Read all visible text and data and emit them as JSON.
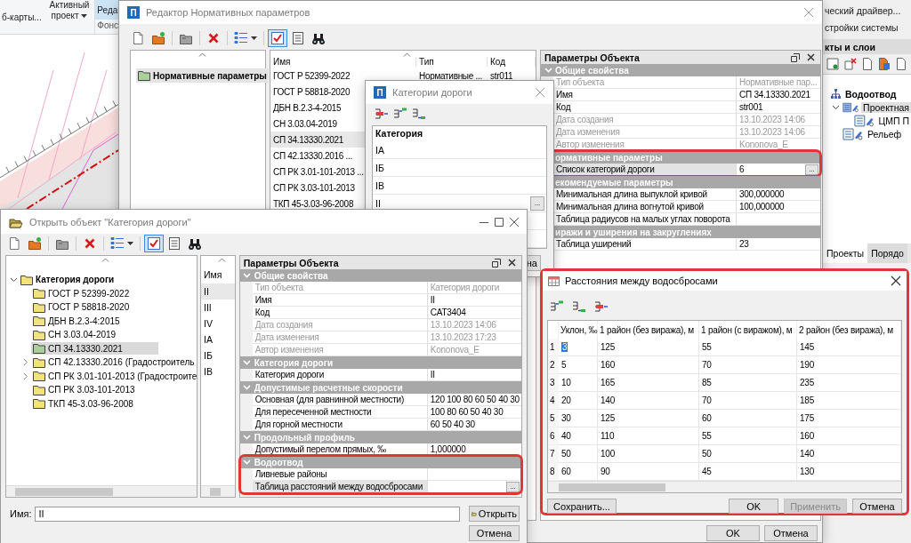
{
  "background_app": {
    "ribbon": [
      {
        "label": "б-карты...",
        "kind": "plain"
      },
      {
        "label": "Активный проект",
        "kind": "dropdown"
      },
      {
        "label": "Реда",
        "kind": "pressed"
      }
    ],
    "ribbon_group": "Фонс",
    "right_ribbon": [
      "ческий драйвер...",
      "стройки системы"
    ],
    "layers_panel": {
      "title": "кты и слои",
      "tree": [
        {
          "label": "Водоотвод",
          "kind": "root",
          "selected": false,
          "children": [
            {
              "label": "Проектная",
              "kind": "surface",
              "expanded": true,
              "selected": true,
              "children": [
                {
                  "label": "ЦМП П",
                  "kind": "surface",
                  "selected": false
                }
              ]
            },
            {
              "label": "Рельеф",
              "kind": "surface",
              "selected": false
            }
          ]
        }
      ]
    },
    "bottom_tabs": [
      {
        "label": "Проекты",
        "selected": true
      },
      {
        "label": "Порядо",
        "selected": false
      }
    ]
  },
  "editor_window": {
    "icon_letter": "П",
    "title": "Редактор Нормативных параметров",
    "toolbar": [
      {
        "kind": "new",
        "pressed": false
      },
      {
        "kind": "open",
        "pressed": false
      },
      {
        "kind": "folder",
        "pressed": false
      },
      {
        "kind": "delete",
        "pressed": false
      },
      {
        "kind": "view",
        "pressed": false
      },
      {
        "kind": "check",
        "pressed": true
      },
      {
        "kind": "details",
        "pressed": false
      },
      {
        "kind": "find",
        "pressed": false
      }
    ],
    "tree": [
      {
        "label": "Нормативные параметры",
        "selected": true
      }
    ],
    "list": {
      "columns": [
        "Имя",
        "Тип",
        "Код"
      ],
      "rows": [
        {
          "cells": [
            "ГОСТ Р 52399-2022",
            "Нормативные ...",
            "str011"
          ],
          "selected": false
        },
        {
          "cells": [
            "ГОСТ Р 58818-2020"
          ],
          "selected": false
        },
        {
          "cells": [
            "ДБН В.2.3-4-2015"
          ],
          "selected": false
        },
        {
          "cells": [
            "СН 3.03.04-2019"
          ],
          "selected": false
        },
        {
          "cells": [
            "СП 34.13330.2021"
          ],
          "selected": true
        },
        {
          "cells": [
            "СП 42.13330.2016 ..."
          ],
          "selected": false
        },
        {
          "cells": [
            "СП РК 3.01-101-2013 ..."
          ],
          "selected": false
        },
        {
          "cells": [
            "СП РК 3.03-101-2013"
          ],
          "selected": false
        },
        {
          "cells": [
            "ТКП 45-3.03-96-2008"
          ],
          "selected": false
        }
      ]
    },
    "properties": {
      "title": "Параметры Объекта",
      "groups": [
        {
          "title": "Общие свойства",
          "expanded": true,
          "highlighted": false,
          "rows": [
            {
              "label": "Тип объекта",
              "value": "Нормативные пар...",
              "disabled": true,
              "selected": false
            },
            {
              "label": "Имя",
              "value": "СП 34.13330.2021",
              "disabled": false,
              "selected": false
            },
            {
              "label": "Код",
              "value": "str001",
              "disabled": false,
              "selected": false
            },
            {
              "label": "Дата создания",
              "value": "13.10.2023 14:06",
              "disabled": true,
              "selected": false
            },
            {
              "label": "Дата изменения",
              "value": "13.10.2023 14:06",
              "disabled": true,
              "selected": false
            },
            {
              "label": "Автор изменения",
              "value": "Kononova_E",
              "disabled": true,
              "selected": false
            }
          ]
        },
        {
          "title": "ормативные параметры",
          "highlighted": true,
          "rows": [
            {
              "label": "Список категорий дороги",
              "value": "6",
              "button": "...",
              "disabled": false,
              "selected": true
            }
          ]
        },
        {
          "title": "екомендуемые параметры",
          "highlighted": false,
          "rows": [
            {
              "label": "Минимальная длина выпуклой кривой",
              "value": "300,000000",
              "disabled": false,
              "selected": false
            },
            {
              "label": "Минимальная длина вогнутой кривой",
              "value": "100,000000",
              "disabled": false,
              "selected": false
            },
            {
              "label": "Таблица радиусов на малых углах поворота",
              "disabled": false,
              "selected": false
            }
          ]
        },
        {
          "title": "иражи и уширения на закруглениях",
          "highlighted": false,
          "rows": [
            {
              "label": "Таблица уширений",
              "value": "23",
              "disabled": false,
              "selected": false
            }
          ]
        }
      ]
    },
    "buttons": [
      {
        "label": "OK",
        "disabled": false
      },
      {
        "label": "Отмена",
        "disabled": false
      }
    ]
  },
  "categories_dialog": {
    "icon_letter": "П",
    "title": "Категории дороги",
    "toolbar": [
      {
        "kind": "row-delete"
      },
      {
        "kind": "row-add"
      },
      {
        "kind": "row-insert"
      }
    ],
    "column": "Категория",
    "rows": [
      {
        "label": "IА"
      },
      {
        "label": "IБ"
      },
      {
        "label": "IВ"
      },
      {
        "label": "II",
        "button": "..."
      }
    ],
    "buttons": [
      "на"
    ]
  },
  "open_dialog": {
    "title": "Открыть объект \"Категория дороги\"",
    "toolbar": [
      {
        "kind": "new",
        "pressed": false
      },
      {
        "kind": "open",
        "pressed": false
      },
      {
        "kind": "folder",
        "pressed": false
      },
      {
        "kind": "delete",
        "pressed": false
      },
      {
        "kind": "view",
        "pressed": false
      },
      {
        "kind": "check",
        "pressed": true
      },
      {
        "kind": "details",
        "pressed": false
      },
      {
        "kind": "find",
        "pressed": false
      }
    ],
    "tree": [
      {
        "label": "Категория дороги",
        "expanded": true,
        "selected": false,
        "children": [
          {
            "label": "ГОСТ Р 52399-2022",
            "selected": false
          },
          {
            "label": "ГОСТ Р 58818-2020",
            "selected": false
          },
          {
            "label": "ДБН В.2.3-4:2015",
            "selected": false
          },
          {
            "label": "СН 3.03.04-2019",
            "selected": false
          },
          {
            "label": "СП 34.13330.2021",
            "selected": true
          },
          {
            "label": "СП 42.13330.2016 (Градостроитель",
            "expanded": false,
            "selected": false
          },
          {
            "label": "СП РК 3.01-101-2013 (Градостроите",
            "expanded": false,
            "selected": false
          },
          {
            "label": "СП РК 3.03-101-2013",
            "selected": false
          },
          {
            "label": "ТКП 45-3.03-96-2008",
            "selected": false
          }
        ]
      }
    ],
    "names": {
      "column": "Имя",
      "items": [
        {
          "label": "II",
          "selected": true
        },
        {
          "label": "III",
          "selected": false
        },
        {
          "label": "IV",
          "selected": false
        },
        {
          "label": "IА",
          "selected": false
        },
        {
          "label": "IБ",
          "selected": false
        },
        {
          "label": "IВ",
          "selected": false
        }
      ]
    },
    "properties": {
      "title": "Параметры Объекта",
      "groups": [
        {
          "title": "Общие свойства",
          "expanded": true,
          "highlighted": false,
          "rows": [
            {
              "label": "Тип объекта",
              "value": "Категория дороги",
              "disabled": true,
              "selected": false
            },
            {
              "label": "Имя",
              "value": "II",
              "disabled": false,
              "selected": false
            },
            {
              "label": "Код",
              "value": "CAT3404",
              "disabled": false,
              "selected": false
            },
            {
              "label": "Дата создания",
              "value": "13.10.2023 14:06",
              "disabled": true,
              "selected": false
            },
            {
              "label": "Дата изменения",
              "value": "13.10.2023 17:23",
              "disabled": true,
              "selected": false
            },
            {
              "label": "Автор изменения",
              "value": "Kononova_E",
              "disabled": true,
              "selected": false
            }
          ]
        },
        {
          "title": "Категория дороги",
          "expanded": true,
          "highlighted": false,
          "rows": [
            {
              "label": "Категория дороги",
              "value": "II",
              "disabled": false,
              "selected": false
            }
          ]
        },
        {
          "title": "Допустимые расчетные скорости",
          "expanded": true,
          "highlighted": false,
          "rows": [
            {
              "label": "Основная (для равнинной местности)",
              "value": "120 100 80 60 50 40 30",
              "disabled": false,
              "selected": false
            },
            {
              "label": "Для пересеченной местности",
              "value": "100 80 60 50 40 30",
              "disabled": false,
              "selected": false
            },
            {
              "label": "Для горной местности",
              "value": "60 50 40 30",
              "disabled": false,
              "selected": false
            }
          ]
        },
        {
          "title": "Продольный профиль",
          "expanded": true,
          "highlighted": false,
          "rows": [
            {
              "label": "Допустимый перелом прямых, ‰",
              "value": "1,000000",
              "disabled": false,
              "selected": false
            }
          ]
        },
        {
          "title": "Водоотвод",
          "expanded": true,
          "highlighted": true,
          "rows": [
            {
              "label": "Ливневые районы",
              "disabled": false,
              "selected": false
            },
            {
              "label": "Таблица расстояний между водосбросами",
              "button": "...",
              "disabled": false,
              "selected": true
            }
          ]
        }
      ]
    },
    "name_field": {
      "label": "Имя:",
      "value": "II"
    },
    "buttons": [
      {
        "label": "Открыть",
        "kind": "open"
      },
      {
        "label": "Отмена",
        "kind": "plain"
      }
    ]
  },
  "water_dialog": {
    "title": "Расстояния между водосбросами",
    "highlighted": true,
    "toolbar": [
      {
        "kind": "row-add"
      },
      {
        "kind": "row-insert"
      },
      {
        "kind": "row-delete"
      }
    ],
    "columns": [
      "Уклон, ‰",
      "1 район (без виража), м",
      "1 район (с виражом), м",
      "2 район (без виража), м"
    ],
    "rows": [
      {
        "number": "1",
        "cells": [
          "3",
          "125",
          "55",
          "145"
        ],
        "selected": true
      },
      {
        "number": "2",
        "cells": [
          "5",
          "160",
          "70",
          "190"
        ],
        "selected": false
      },
      {
        "number": "3",
        "cells": [
          "10",
          "165",
          "85",
          "235"
        ],
        "selected": false
      },
      {
        "number": "4",
        "cells": [
          "20",
          "140",
          "70",
          "185"
        ],
        "selected": false
      },
      {
        "number": "5",
        "cells": [
          "30",
          "125",
          "60",
          "175"
        ],
        "selected": false
      },
      {
        "number": "6",
        "cells": [
          "40",
          "110",
          "55",
          "160"
        ],
        "selected": false
      },
      {
        "number": "7",
        "cells": [
          "50",
          "100",
          "50",
          "140"
        ],
        "selected": false
      },
      {
        "number": "8",
        "cells": [
          "60",
          "90",
          "45",
          "130"
        ],
        "selected": false
      }
    ],
    "buttons": [
      {
        "label": "Сохранить...",
        "disabled": false
      },
      {
        "label": "OK",
        "disabled": false
      },
      {
        "label": "Применить",
        "disabled": true
      },
      {
        "label": "Отмена",
        "disabled": false
      }
    ]
  }
}
